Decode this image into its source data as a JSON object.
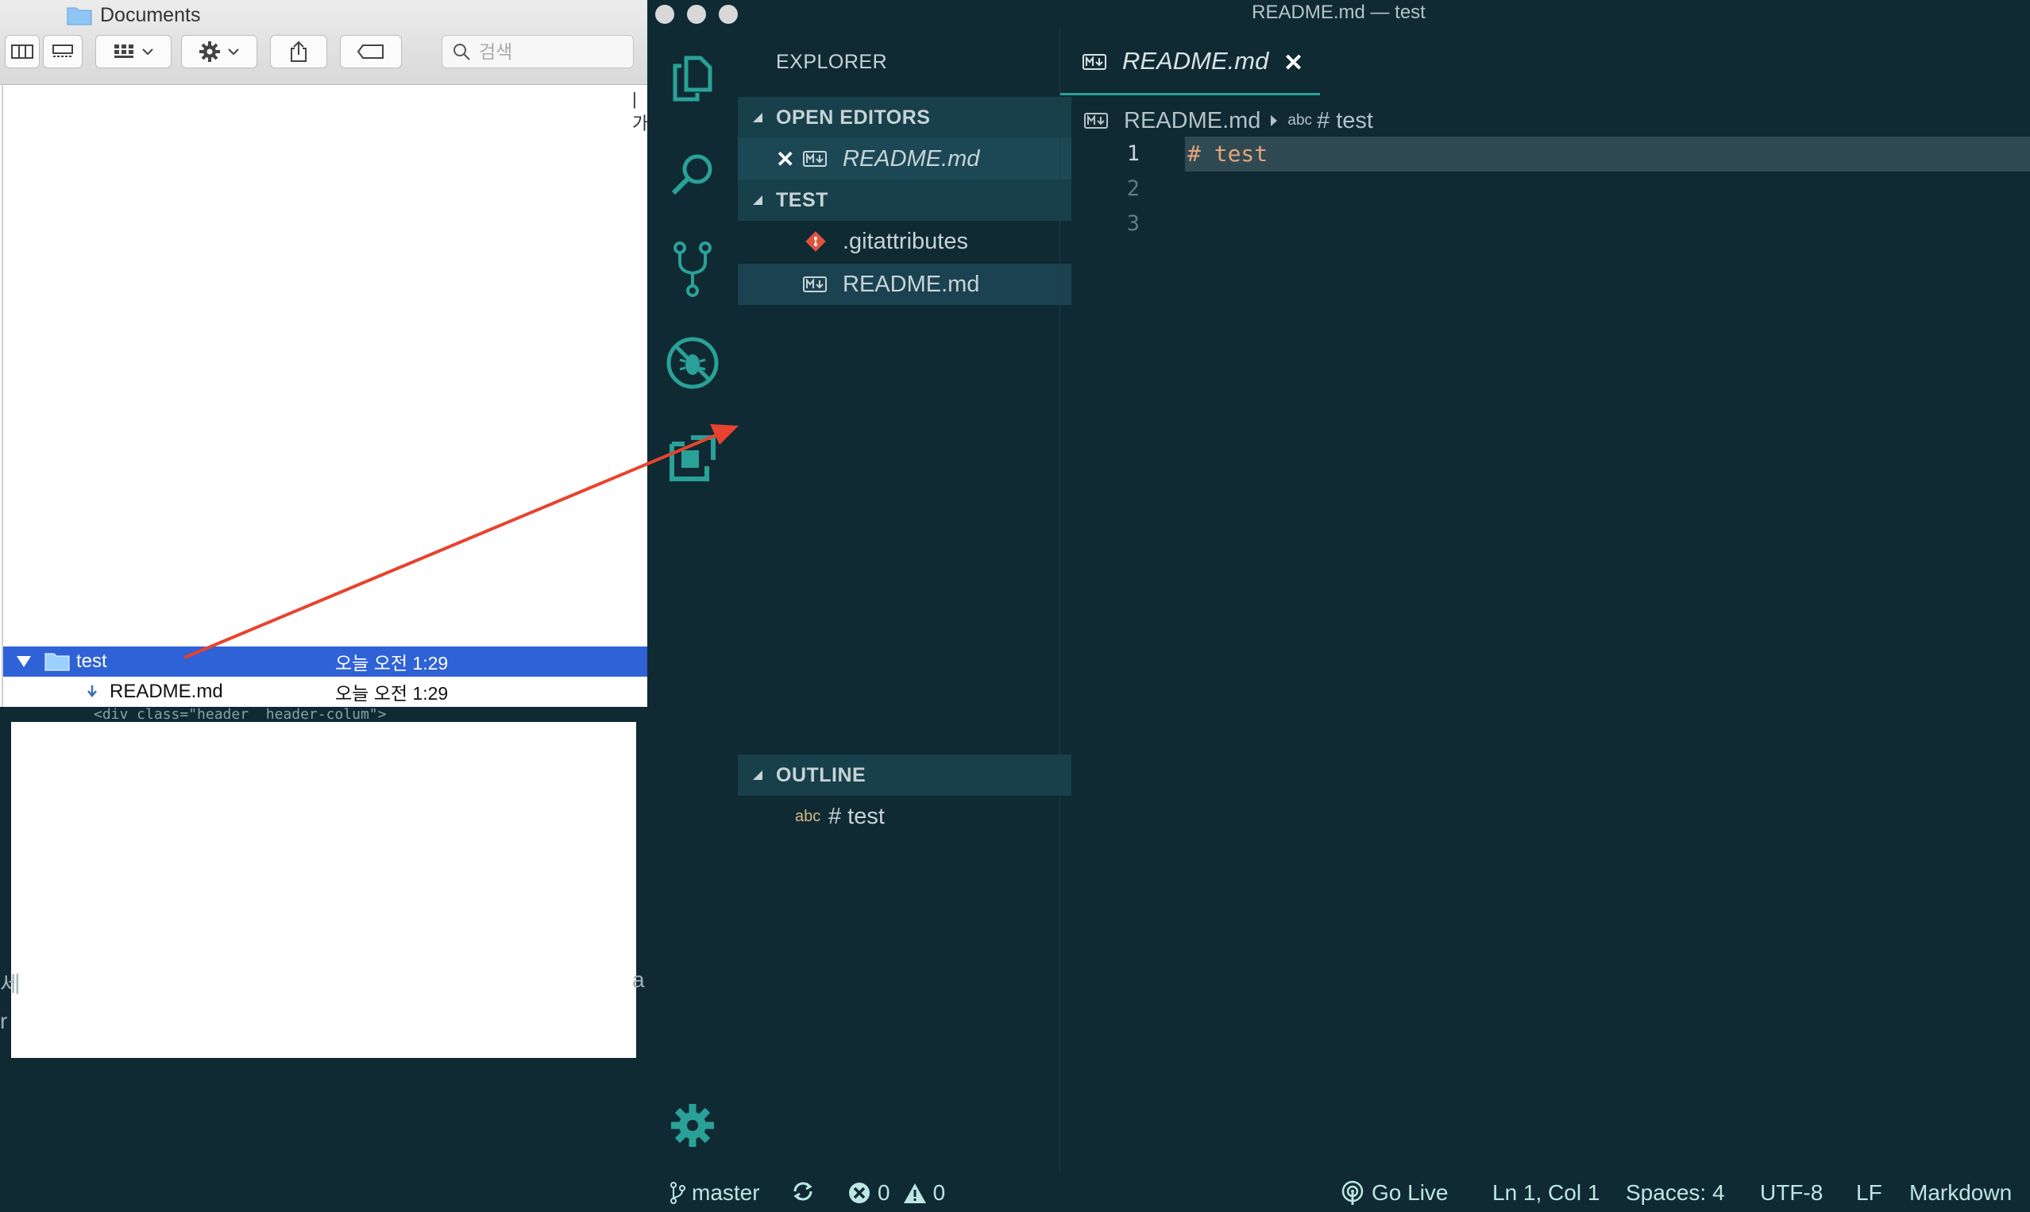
{
  "finder": {
    "window_title": "Documents",
    "search": {
      "placeholder": "검색",
      "value": ""
    },
    "edge_text": "|가",
    "rows": [
      {
        "name": "test",
        "date": "오늘 오전 1:29"
      },
      {
        "name": "README.md",
        "date": "오늘 오전 1:29"
      }
    ]
  },
  "background_fragments": {
    "code_snippet": "<div class=\"header  header-colum\">",
    "left_edge_1": "세",
    "left_edge_2": "r",
    "right_edge": "a"
  },
  "vscode": {
    "window_title": "README.md — test",
    "explorer_title": "EXPLORER",
    "sections": {
      "open_editors": "OPEN EDITORS",
      "workspace": "TEST",
      "outline": "OUTLINE"
    },
    "open_editors": [
      {
        "label": "README.md"
      }
    ],
    "files": [
      {
        "label": ".gitattributes"
      },
      {
        "label": "README.md"
      }
    ],
    "outline": [
      {
        "kind": "abc",
        "label": "# test"
      }
    ],
    "tab": {
      "label": "README.md",
      "close": "✕"
    },
    "breadcrumb": {
      "file": "README.md",
      "kind": "abc",
      "symbol": "# test"
    },
    "editor": {
      "line_numbers": [
        "1",
        "2",
        "3"
      ],
      "lines": [
        "# test",
        "",
        ""
      ]
    },
    "statusbar": {
      "branch": "master",
      "errors": "0",
      "warnings": "0",
      "go_live": "Go Live",
      "position": "Ln 1, Col 1",
      "spaces": "Spaces: 4",
      "encoding": "UTF-8",
      "eol": "LF",
      "language": "Markdown"
    },
    "colors": {
      "background": "#0f2a33",
      "accent": "#2aa198",
      "icon_teal": "#2aa198",
      "annotation_arrow": "#e8432e"
    }
  }
}
